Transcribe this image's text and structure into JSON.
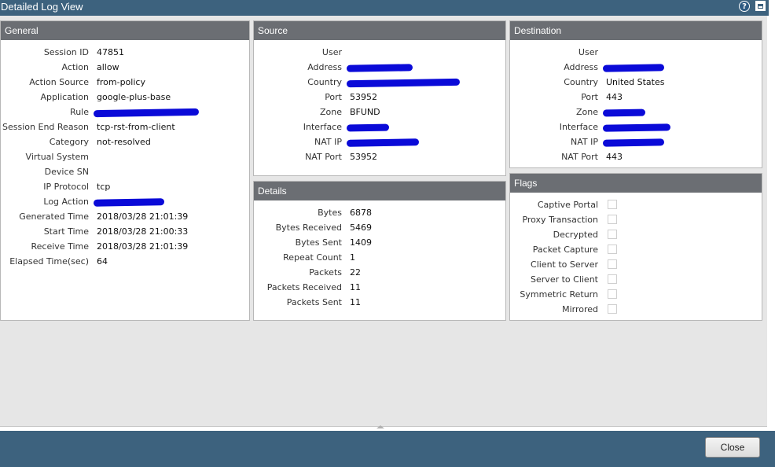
{
  "window": {
    "title": "Detailed Log View",
    "help_icon": "?"
  },
  "general": {
    "header": "General",
    "rows": [
      {
        "label": "Session ID",
        "value": "47851"
      },
      {
        "label": "Action",
        "value": "allow"
      },
      {
        "label": "Action Source",
        "value": "from-policy"
      },
      {
        "label": "Application",
        "value": "google-plus-base"
      },
      {
        "label": "Rule",
        "value": "",
        "redacted": true
      },
      {
        "label": "Session End Reason",
        "value": "tcp-rst-from-client"
      },
      {
        "label": "Category",
        "value": "not-resolved"
      },
      {
        "label": "Virtual System",
        "value": ""
      },
      {
        "label": "Device SN",
        "value": ""
      },
      {
        "label": "IP Protocol",
        "value": "tcp"
      },
      {
        "label": "Log Action",
        "value": "",
        "redacted": true
      },
      {
        "label": "Generated Time",
        "value": "2018/03/28 21:01:39"
      },
      {
        "label": "Start Time",
        "value": "2018/03/28 21:00:33"
      },
      {
        "label": "Receive Time",
        "value": "2018/03/28 21:01:39"
      },
      {
        "label": "Elapsed Time(sec)",
        "value": "64"
      }
    ]
  },
  "source": {
    "header": "Source",
    "rows": [
      {
        "label": "User",
        "value": ""
      },
      {
        "label": "Address",
        "value": "",
        "redacted": true
      },
      {
        "label": "Country",
        "value": "",
        "redacted": true
      },
      {
        "label": "Port",
        "value": "53952"
      },
      {
        "label": "Zone",
        "value": "BFUND"
      },
      {
        "label": "Interface",
        "value": "",
        "redacted": true
      },
      {
        "label": "NAT IP",
        "value": "",
        "redacted": true
      },
      {
        "label": "NAT Port",
        "value": "53952"
      }
    ]
  },
  "destination": {
    "header": "Destination",
    "rows": [
      {
        "label": "User",
        "value": ""
      },
      {
        "label": "Address",
        "value": "",
        "redacted": true
      },
      {
        "label": "Country",
        "value": "United States"
      },
      {
        "label": "Port",
        "value": "443"
      },
      {
        "label": "Zone",
        "value": "",
        "redacted": true
      },
      {
        "label": "Interface",
        "value": "",
        "redacted": true
      },
      {
        "label": "NAT IP",
        "value": "",
        "redacted": true
      },
      {
        "label": "NAT Port",
        "value": "443"
      }
    ]
  },
  "details": {
    "header": "Details",
    "rows": [
      {
        "label": "Bytes",
        "value": "6878"
      },
      {
        "label": "Bytes Received",
        "value": "5469"
      },
      {
        "label": "Bytes Sent",
        "value": "1409"
      },
      {
        "label": "Repeat Count",
        "value": "1"
      },
      {
        "label": "Packets",
        "value": "22"
      },
      {
        "label": "Packets Received",
        "value": "11"
      },
      {
        "label": "Packets Sent",
        "value": "11"
      }
    ]
  },
  "flags": {
    "header": "Flags",
    "rows": [
      {
        "label": "Captive Portal",
        "checked": false
      },
      {
        "label": "Proxy Transaction",
        "checked": false
      },
      {
        "label": "Decrypted",
        "checked": false
      },
      {
        "label": "Packet Capture",
        "checked": false
      },
      {
        "label": "Client to Server",
        "checked": false
      },
      {
        "label": "Server to Client",
        "checked": false
      },
      {
        "label": "Symmetric Return",
        "checked": false
      },
      {
        "label": "Mirrored",
        "checked": false
      }
    ]
  },
  "footer": {
    "close_label": "Close"
  },
  "colors": {
    "titlebar": "#3d627e",
    "panel_header": "#6b6e73",
    "redaction": "#0a0ad8"
  }
}
